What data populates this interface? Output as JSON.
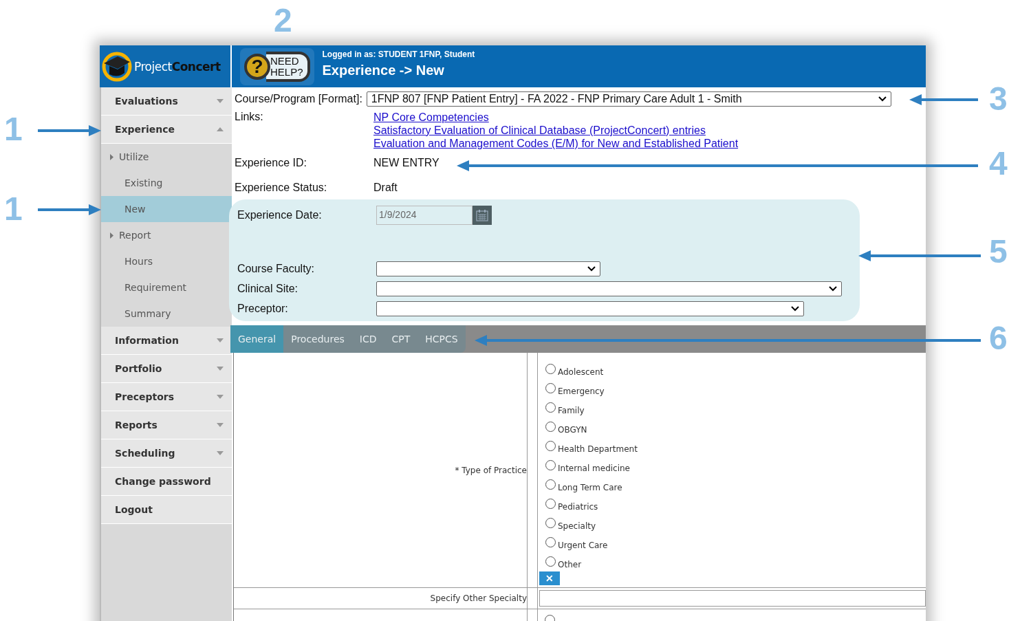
{
  "annotations": [
    {
      "label": "1",
      "kind": "rightarrow"
    },
    {
      "label": "1",
      "kind": "rightarrow"
    },
    {
      "label": "2",
      "kind": "plain"
    },
    {
      "label": "3",
      "kind": "leftarrow"
    },
    {
      "label": "4",
      "kind": "leftarrow"
    },
    {
      "label": "5",
      "kind": "leftarrow"
    },
    {
      "label": "6",
      "kind": "leftarrow"
    }
  ],
  "logo": {
    "part1": "Project",
    "part2": "Concert"
  },
  "help_button": {
    "icon": "?",
    "line1": "NEED",
    "line2": "HELP?"
  },
  "header": {
    "logged_in": "Logged in as: STUDENT 1FNP, Student",
    "title": "Experience -> New"
  },
  "sidebar": {
    "items": [
      {
        "label": "Evaluations",
        "kind": "dropdown",
        "expanded": false
      },
      {
        "label": "Experience",
        "kind": "dropdown",
        "expanded": true,
        "children": [
          {
            "label": "Utilize",
            "children": [
              {
                "label": "Existing",
                "selected": false
              },
              {
                "label": "New",
                "selected": true
              }
            ]
          },
          {
            "label": "Report",
            "children": [
              {
                "label": "Hours",
                "selected": false
              },
              {
                "label": "Requirement",
                "selected": false
              },
              {
                "label": "Summary",
                "selected": false
              }
            ]
          }
        ]
      },
      {
        "label": "Information",
        "kind": "dropdown",
        "expanded": false
      },
      {
        "label": "Portfolio",
        "kind": "dropdown",
        "expanded": false
      },
      {
        "label": "Preceptors",
        "kind": "dropdown",
        "expanded": false
      },
      {
        "label": "Reports",
        "kind": "dropdown",
        "expanded": false
      },
      {
        "label": "Scheduling",
        "kind": "dropdown",
        "expanded": false
      },
      {
        "label": "Change password",
        "kind": "link"
      },
      {
        "label": "Logout",
        "kind": "link"
      }
    ]
  },
  "form": {
    "course": {
      "label": "Course/Program [Format]:",
      "value": "1FNP 807 [FNP Patient Entry] - FA 2022 - FNP Primary Care Adult 1 - Smith"
    },
    "links_label": "Links:",
    "links": [
      "NP Core Competencies",
      "Satisfactory Evaluation of Clinical Database (ProjectConcert) entries",
      "Evaluation and Management Codes (E/M) for New and Established Patient"
    ],
    "experience_id": {
      "label": "Experience ID:",
      "value": "NEW ENTRY"
    },
    "experience_status": {
      "label": "Experience Status:",
      "value": "Draft"
    },
    "experience_date": {
      "label": "Experience Date:",
      "value": "1/9/2024",
      "disabled": true
    },
    "selects": [
      {
        "label": "Course Faculty:"
      },
      {
        "label": "Clinical Site:"
      },
      {
        "label": "Preceptor:"
      }
    ]
  },
  "tabs": [
    {
      "label": "General",
      "selected": true
    },
    {
      "label": "Procedures",
      "selected": false
    },
    {
      "label": "ICD",
      "selected": false
    },
    {
      "label": "CPT",
      "selected": false
    },
    {
      "label": "HCPCS",
      "selected": false
    }
  ],
  "type_of_practice": {
    "label": "* Type of Practice",
    "options": [
      {
        "label": "Adolescent",
        "selected": false
      },
      {
        "label": "Emergency",
        "selected": false
      },
      {
        "label": "Family",
        "selected": false
      },
      {
        "label": "OBGYN",
        "selected": false
      },
      {
        "label": "Health Department",
        "selected": false
      },
      {
        "label": "Internal medicine",
        "selected": false
      },
      {
        "label": "Long Term Care",
        "selected": false
      },
      {
        "label": "Pediatrics",
        "selected": false
      },
      {
        "label": "Specialty",
        "selected": false
      },
      {
        "label": "Urgent Care",
        "selected": false
      },
      {
        "label": "Other",
        "selected": false
      }
    ],
    "clear_button": "✕"
  },
  "specify_other": {
    "label": "Specify Other Specialty"
  },
  "next_question": {
    "options": [
      {
        "selected": false
      }
    ]
  }
}
